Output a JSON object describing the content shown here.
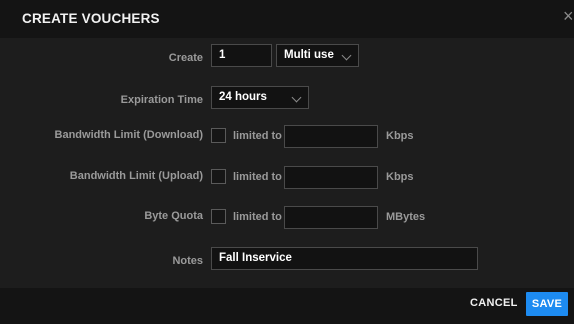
{
  "dialog": {
    "title": "CREATE VOUCHERS",
    "close_icon": "×"
  },
  "form": {
    "create": {
      "label": "Create",
      "value": "1",
      "mode": "Multi use"
    },
    "expiration": {
      "label": "Expiration Time",
      "value": "24 hours"
    },
    "bw_download": {
      "label": "Bandwidth Limit (Download)",
      "checkbox_label": "limited to",
      "value": "",
      "unit": "Kbps",
      "checked": false
    },
    "bw_upload": {
      "label": "Bandwidth Limit (Upload)",
      "checkbox_label": "limited to",
      "value": "",
      "unit": "Kbps",
      "checked": false
    },
    "byte_quota": {
      "label": "Byte Quota",
      "checkbox_label": "limited to",
      "value": "",
      "unit": "MBytes",
      "checked": false
    },
    "notes": {
      "label": "Notes",
      "value": "Fall Inservice"
    }
  },
  "footer": {
    "cancel_label": "CANCEL",
    "save_label": "SAVE"
  },
  "colors": {
    "accent": "#1d8bf1",
    "header_bg": "#141414",
    "body_bg": "#1d1d1d"
  }
}
